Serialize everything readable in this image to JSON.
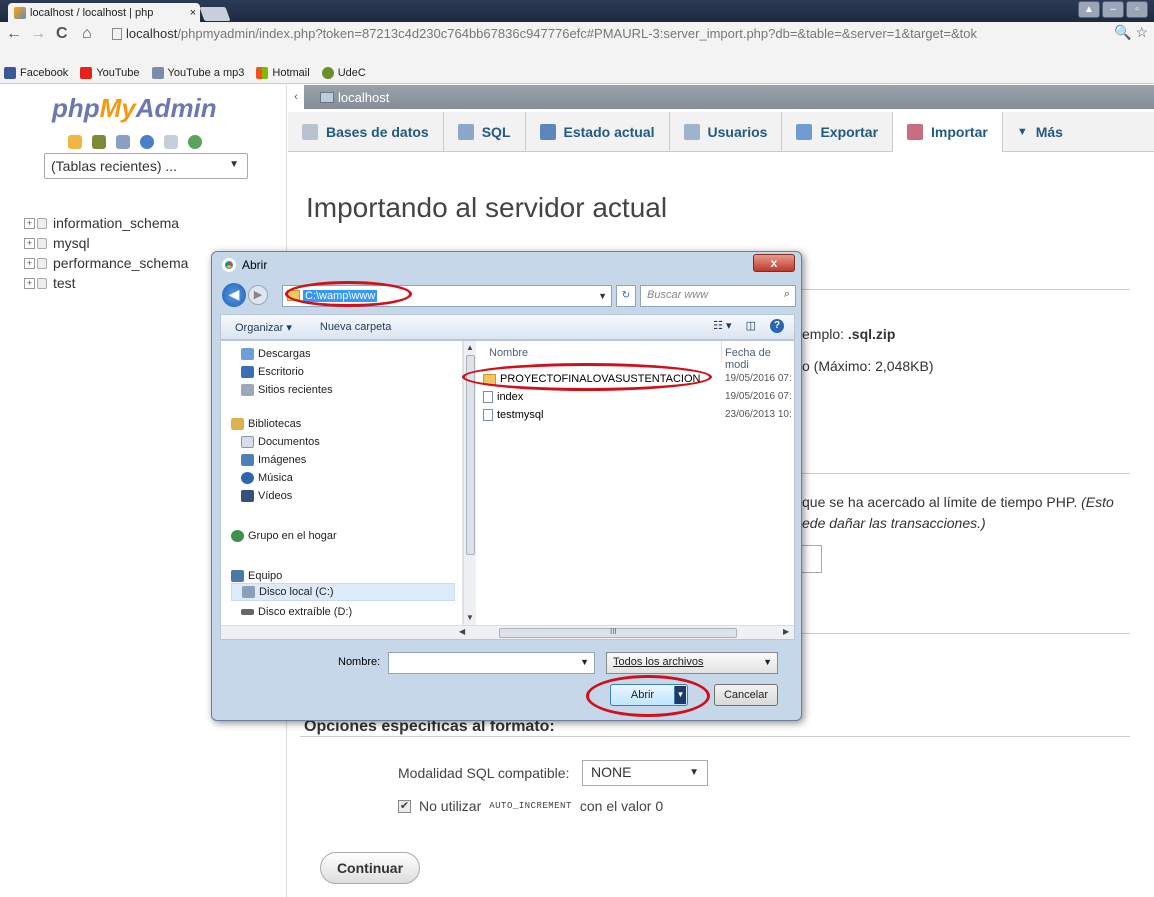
{
  "browser": {
    "tab_title": "localhost / localhost | php",
    "tab_close": "×",
    "url_host": "localhost",
    "url_rest": "/phpmyadmin/index.php?token=87213c4d230c764bb67836c947776efc#PMAURL-3:server_import.php?db=&table=&server=1&target=&tok",
    "nav_back": "←",
    "nav_forward": "→",
    "nav_reload": "C",
    "nav_home": "⌂",
    "actions": "🔍 ☆",
    "window_buttons": [
      "▲",
      "–",
      "▫"
    ],
    "bookmarks": [
      {
        "label": "Facebook",
        "color": "#3b5998"
      },
      {
        "label": "YouTube",
        "color": "#e62117"
      },
      {
        "label": "YouTube a mp3",
        "color": "#7a8ca8"
      },
      {
        "label": "Hotmail",
        "color": "#f25022"
      },
      {
        "label": "UdeC",
        "color": "#6a8e2a"
      }
    ]
  },
  "sidebar": {
    "logo_php": "php",
    "logo_my": "My",
    "logo_admin": "Admin",
    "recent_tables": "(Tablas recientes) ...",
    "databases": [
      "information_schema",
      "mysql",
      "performance_schema",
      "test"
    ]
  },
  "main": {
    "breadcrumb_collapse": "‹",
    "breadcrumb_server": "localhost",
    "menu": [
      {
        "label": "Bases de datos",
        "icon_color": "#b8c2cf"
      },
      {
        "label": "SQL",
        "icon_color": "#8ca7c8"
      },
      {
        "label": "Estado actual",
        "icon_color": "#5f86b8"
      },
      {
        "label": "Usuarios",
        "icon_color": "#9fb3cd"
      },
      {
        "label": "Exportar",
        "icon_color": "#6e9bd1"
      },
      {
        "label": "Importar",
        "icon_color": "#c96d80"
      },
      {
        "label": "Más",
        "icon_color": ""
      }
    ],
    "more_caret": "▼",
    "page_title": "Importando al servidor actual",
    "frag_example_prefix": "emplo: ",
    "frag_example_ext": ".sql.zip",
    "frag_max": "o (Máximo: 2,048KB)",
    "frag_timeout": "que se ha acercado al límite de tiempo PHP. ",
    "frag_timeout_italic": "(Esto",
    "frag_transactions": "ede dañar las transacciones.)",
    "format_options_title": "Opciones específicas al formato:",
    "sql_mode_label": "Modalidad SQL compatible:",
    "sql_mode_value": "NONE",
    "autoinc_prefix": "No utilizar",
    "autoinc_code": "AUTO_INCREMENT",
    "autoinc_suffix": "con el valor 0",
    "autoinc_checked": "✔",
    "continue_button": "Continuar"
  },
  "dialog": {
    "title": "Abrir",
    "close": "x",
    "back": "◀",
    "forward": "▶",
    "path": "C:\\wamp\\www",
    "path_dropdown": "▼",
    "refresh": "↻",
    "search_placeholder": "Buscar www",
    "search_icon": "⌕",
    "organize": "Organizar ▾",
    "new_folder": "Nueva carpeta",
    "view_toggle": "☷ ▾",
    "preview_pane": "◫",
    "help": "?",
    "nav": {
      "descargas": "Descargas",
      "escritorio": "Escritorio",
      "recientes": "Sitios recientes",
      "bibliotecas": "Bibliotecas",
      "documentos": "Documentos",
      "imagenes": "Imágenes",
      "musica": "Música",
      "videos": "Vídeos",
      "grupo": "Grupo en el hogar",
      "equipo": "Equipo",
      "disco_c": "Disco local (C:)",
      "disco_d": "Disco extraíble (D:)"
    },
    "col_name": "Nombre",
    "col_date": "Fecha de modi",
    "files": [
      {
        "name": "PROYECTOFINALOVASUSTENTACION",
        "date": "19/05/2016 07:",
        "type": "folder"
      },
      {
        "name": "index",
        "date": "19/05/2016 07:",
        "type": "file"
      },
      {
        "name": "testmysql",
        "date": "23/06/2013 10:",
        "type": "file"
      }
    ],
    "hscroll_mid": "III",
    "name_label": "Nombre:",
    "name_value": "",
    "file_type": "Todos los archivos",
    "open_button": "Abrir",
    "cancel_button": "Cancelar"
  }
}
